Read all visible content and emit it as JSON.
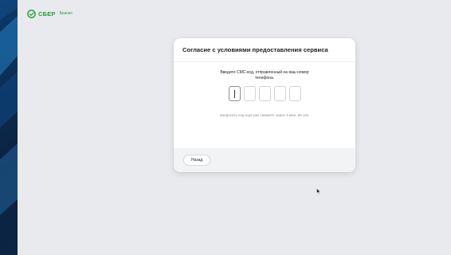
{
  "brand": {
    "name": "СБЕР",
    "sub": "Бизнес",
    "color": "#21a038"
  },
  "modal": {
    "title": "Согласие с условиями предоставления сервиса",
    "instruction": "Введите СМС-код, отправленный на ваш номер телефона.",
    "code_length": 5,
    "code_values": [
      "",
      "",
      "",
      "",
      ""
    ],
    "resend_text": "Запросить код ещё раз сможете через 4 мин. 56 сек.",
    "back_label": "Назад"
  },
  "colors": {
    "page_bg": "#e9eaed",
    "modal_bg": "#ffffff",
    "footer_bg": "#f2f3f5"
  },
  "icons": {
    "logo": "sber-logo-icon",
    "cursor": "mouse-cursor-icon"
  }
}
